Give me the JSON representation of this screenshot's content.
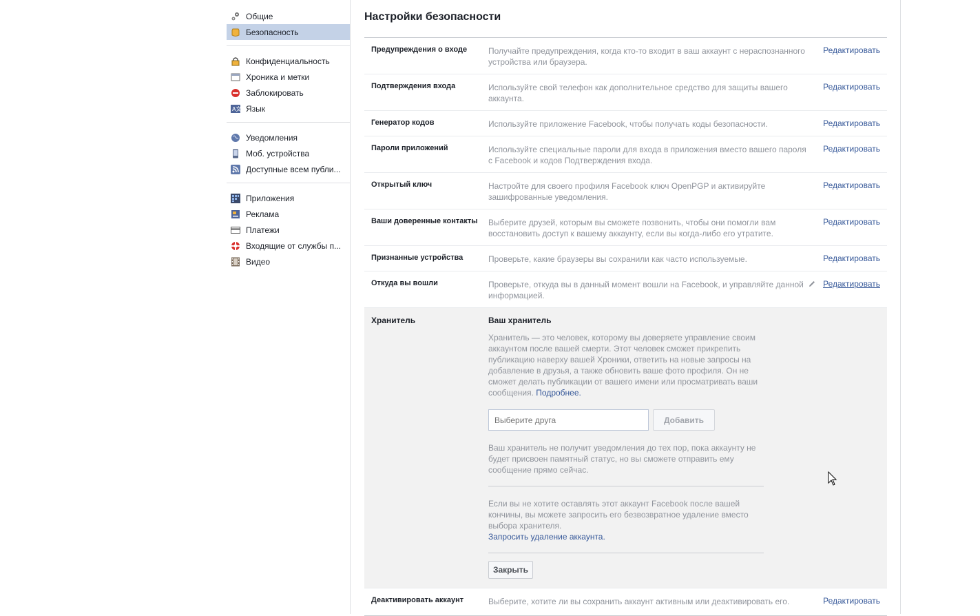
{
  "sidebar": {
    "groups": [
      [
        {
          "label": "Общие",
          "icon": "gears-icon"
        },
        {
          "label": "Безопасность",
          "icon": "shield-icon",
          "active": true
        }
      ],
      [
        {
          "label": "Конфиденциальность",
          "icon": "lock-icon"
        },
        {
          "label": "Хроника и метки",
          "icon": "timeline-icon"
        },
        {
          "label": "Заблокировать",
          "icon": "block-icon"
        },
        {
          "label": "Язык",
          "icon": "language-icon"
        }
      ],
      [
        {
          "label": "Уведомления",
          "icon": "globe-icon"
        },
        {
          "label": "Моб. устройства",
          "icon": "mobile-icon"
        },
        {
          "label": "Доступные всем публи...",
          "icon": "rss-icon"
        }
      ],
      [
        {
          "label": "Приложения",
          "icon": "apps-icon"
        },
        {
          "label": "Реклама",
          "icon": "ads-icon"
        },
        {
          "label": "Платежи",
          "icon": "card-icon"
        },
        {
          "label": "Входящие от службы п...",
          "icon": "lifebuoy-icon"
        },
        {
          "label": "Видео",
          "icon": "film-icon"
        }
      ]
    ]
  },
  "page": {
    "title": "Настройки безопасности"
  },
  "edit_label": "Редактировать",
  "settings": [
    {
      "title": "Предупреждения о входе",
      "desc": "Получайте предупреждения, когда кто-то входит в ваш аккаунт с нераспознанного устройства или браузера."
    },
    {
      "title": "Подтверждения входа",
      "desc": "Используйте свой телефон как дополнительное средство для защиты вашего аккаунта."
    },
    {
      "title": "Генератор кодов",
      "desc": "Используйте приложение Facebook, чтобы получать коды безопасности."
    },
    {
      "title": "Пароли приложений",
      "desc": "Используйте специальные пароли для входа в приложения вместо вашего пароля с Facebook и кодов Подтверждения входа."
    },
    {
      "title": "Открытый ключ",
      "desc": "Настройте для своего профиля Facebook ключ OpenPGP и активируйте зашифрованные уведомления."
    },
    {
      "title": "Ваши доверенные контакты",
      "desc": "Выберите друзей, которым вы сможете позвонить, чтобы они помогли вам восстановить доступ к вашему аккаунту, если вы когда-либо его утратите."
    },
    {
      "title": "Признанные устройства",
      "desc": "Проверьте, какие браузеры вы сохранили как часто используемые."
    },
    {
      "title": "Откуда вы вошли",
      "desc": "Проверьте, откуда вы в данный момент вошли на Facebook, и управляйте данной информацией."
    }
  ],
  "guardian": {
    "title": "Хранитель",
    "heading": "Ваш хранитель",
    "description": "Хранитель — это человек, которому вы доверяете управление своим аккаунтом после вашей смерти. Этот человек сможет прикрепить публикацию наверху вашей Хроники, ответить на новые запросы на добавление в друзья, а также обновить ваше фото профиля. Он не сможет делать публикации от вашего имени или просматривать ваши сообщения.",
    "learn_more": "Подробнее.",
    "friend_placeholder": "Выберите друга",
    "add_label": "Добавить",
    "notice": "Ваш хранитель не получит уведомления до тех пор, пока аккаунту не будет присвоен памятный статус, но вы сможете отправить ему сообщение прямо сейчас.",
    "delete_text": "Если вы не хотите оставлять этот аккаунт Facebook после вашей кончины, вы можете запросить его безвозвратное удаление вместо выбора хранителя.",
    "delete_link": "Запросить удаление аккаунта.",
    "close_label": "Закрыть"
  },
  "deactivate": {
    "title": "Деактивировать аккаунт",
    "desc": "Выберите, хотите ли вы сохранить аккаунт активным или деактивировать его."
  }
}
